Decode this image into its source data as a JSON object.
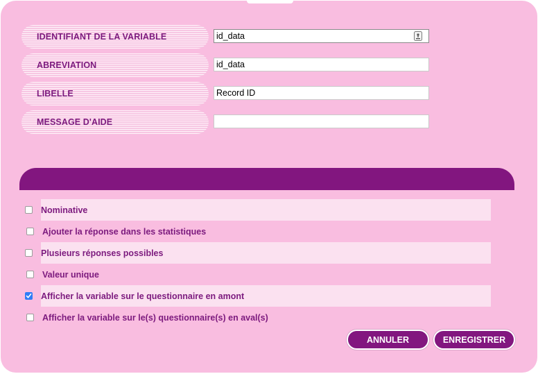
{
  "fields": [
    {
      "label": "IDENTIFIANT DE LA VARIABLE",
      "value": "id_data",
      "placeholder": ""
    },
    {
      "label": "ABREVIATION",
      "value": "id_data",
      "placeholder": ""
    },
    {
      "label": "LIBELLE",
      "value": "Record ID",
      "placeholder": ""
    },
    {
      "label": "MESSAGE D'AIDE",
      "value": "",
      "placeholder": ""
    }
  ],
  "options": [
    {
      "label": "Nominative",
      "checked": false
    },
    {
      "label": "Ajouter la réponse dans les statistiques",
      "checked": false
    },
    {
      "label": "Plusieurs réponses possibles",
      "checked": false
    },
    {
      "label": "Valeur unique",
      "checked": false
    },
    {
      "label": "Afficher la variable sur le questionnaire en amont",
      "checked": true
    },
    {
      "label": "Afficher la variable sur le(s) questionnaire(s) en aval(s)",
      "checked": false
    }
  ],
  "buttons": {
    "cancel": "ANNULER",
    "save": "ENREGISTRER"
  },
  "colors": {
    "background": "#f9bde0",
    "accent": "#82167f",
    "label_text": "#7c1a7e",
    "checkbox_checked": "#2f7df6"
  },
  "icons": {
    "field_key": "key-icon",
    "checkmark": "checkmark-icon"
  }
}
